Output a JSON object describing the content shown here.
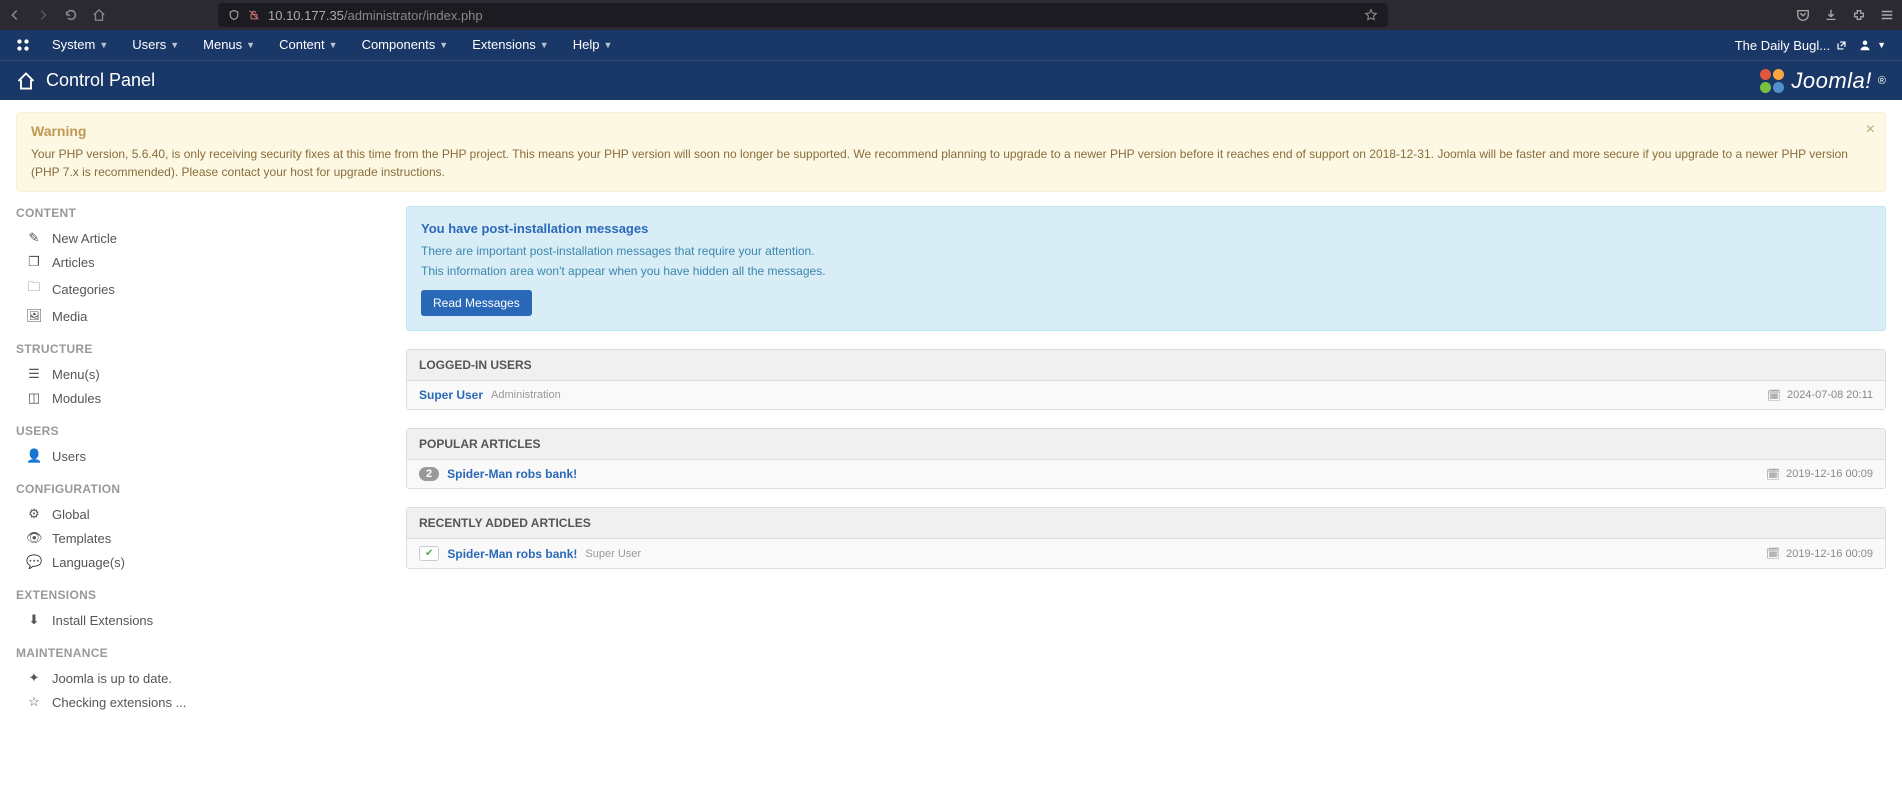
{
  "browser": {
    "url_host": "10.10.177.35",
    "url_path": "/administrator/index.php"
  },
  "top_menu": {
    "items": [
      "System",
      "Users",
      "Menus",
      "Content",
      "Components",
      "Extensions",
      "Help"
    ],
    "site_name": "The Daily Bugl..."
  },
  "title_bar": {
    "title": "Control Panel",
    "brand": "Joomla!"
  },
  "warning": {
    "heading": "Warning",
    "body": "Your PHP version, 5.6.40, is only receiving security fixes at this time from the PHP project. This means your PHP version will soon no longer be supported. We recommend planning to upgrade to a newer PHP version before it reaches end of support on 2018-12-31. Joomla will be faster and more secure if you upgrade to a newer PHP version (PHP 7.x is recommended). Please contact your host for upgrade instructions."
  },
  "sidebar": {
    "sections": {
      "content": {
        "title": "CONTENT",
        "items": [
          "New Article",
          "Articles",
          "Categories",
          "Media"
        ]
      },
      "structure": {
        "title": "STRUCTURE",
        "items": [
          "Menu(s)",
          "Modules"
        ]
      },
      "users": {
        "title": "USERS",
        "items": [
          "Users"
        ]
      },
      "configuration": {
        "title": "CONFIGURATION",
        "items": [
          "Global",
          "Templates",
          "Language(s)"
        ]
      },
      "extensions": {
        "title": "EXTENSIONS",
        "items": [
          "Install Extensions"
        ]
      },
      "maintenance": {
        "title": "MAINTENANCE",
        "items": [
          "Joomla is up to date.",
          "Checking extensions ..."
        ]
      }
    }
  },
  "post_install": {
    "heading": "You have post-installation messages",
    "line1": "There are important post-installation messages that require your attention.",
    "line2": "This information area won't appear when you have hidden all the messages.",
    "button": "Read Messages"
  },
  "panels": {
    "logged_in": {
      "title": "LOGGED-IN USERS",
      "rows": [
        {
          "user": "Super User",
          "role": "Administration",
          "time": "2024-07-08 20:11"
        }
      ]
    },
    "popular": {
      "title": "POPULAR ARTICLES",
      "rows": [
        {
          "count": "2",
          "title": "Spider-Man robs bank!",
          "time": "2019-12-16 00:09"
        }
      ]
    },
    "recent": {
      "title": "RECENTLY ADDED ARTICLES",
      "rows": [
        {
          "title": "Spider-Man robs bank!",
          "author": "Super User",
          "time": "2019-12-16 00:09"
        }
      ]
    }
  }
}
